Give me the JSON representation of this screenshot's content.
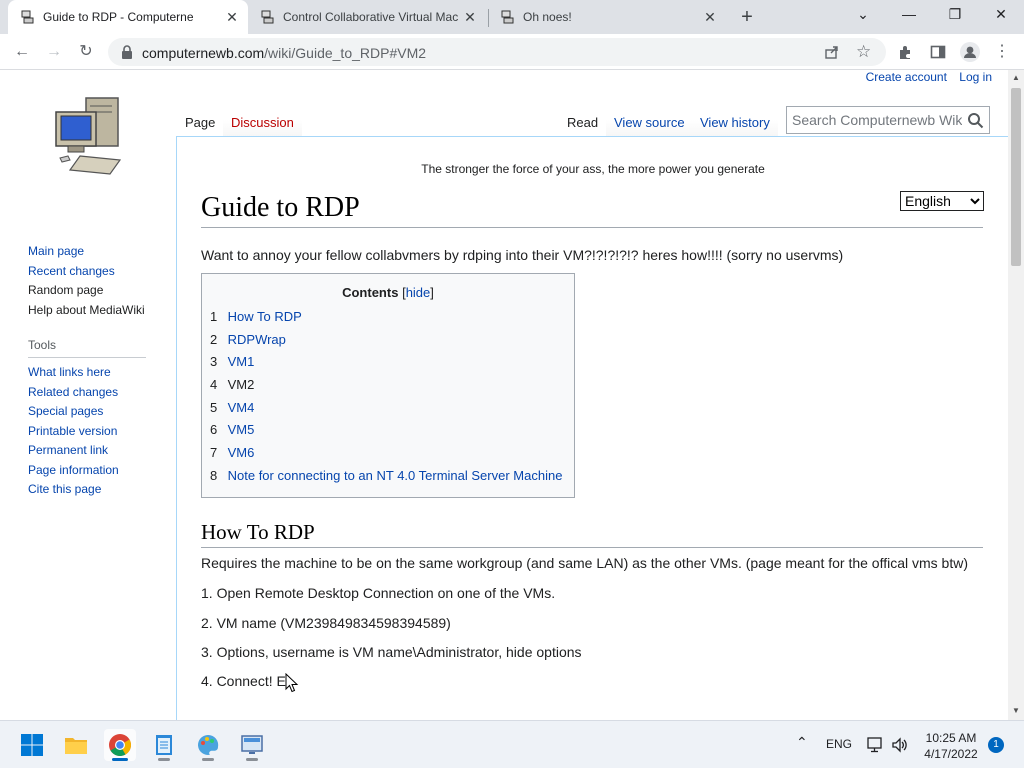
{
  "browser": {
    "tabs": [
      {
        "title": "Guide to RDP - Computernewb W",
        "close": "✕"
      },
      {
        "title": "Control Collaborative Virtual Mac",
        "close": "✕"
      },
      {
        "title": "Oh noes!",
        "close": "✕"
      }
    ],
    "new_tab": "+",
    "window_controls": {
      "tabsearch": "⌄",
      "minimize": "—",
      "restore": "❐",
      "close": "✕"
    },
    "url_host": "computernewb.com",
    "url_path": "/wiki/Guide_to_RDP#VM2"
  },
  "wiki": {
    "personal": {
      "create_account": "Create account",
      "login": "Log in"
    },
    "tabs": {
      "page": "Page",
      "discussion": "Discussion",
      "read": "Read",
      "view_source": "View source",
      "view_history": "View history"
    },
    "search_placeholder": "Search Computernewb Wiki",
    "sidebar": {
      "nav": [
        "Main page",
        "Recent changes",
        "Random page",
        "Help about MediaWiki"
      ],
      "tools_heading": "Tools",
      "tools": [
        "What links here",
        "Related changes",
        "Special pages",
        "Printable version",
        "Permanent link",
        "Page information",
        "Cite this page"
      ]
    },
    "site_notice": "The stronger the force of your ass, the more power you generate",
    "language": "English",
    "title": "Guide to RDP",
    "intro": "Want to annoy your fellow collabvmers by rdping into their VM?!?!?!?!? heres how!!!! (sorry no uservms)",
    "toc": {
      "title": "Contents",
      "toggle": "hide",
      "open_bracket": "[",
      "close_bracket": "]",
      "items": [
        {
          "num": "1",
          "label": "How To RDP"
        },
        {
          "num": "2",
          "label": "RDPWrap"
        },
        {
          "num": "3",
          "label": "VM1"
        },
        {
          "num": "4",
          "label": "VM2"
        },
        {
          "num": "5",
          "label": "VM4"
        },
        {
          "num": "6",
          "label": "VM5"
        },
        {
          "num": "7",
          "label": "VM6"
        },
        {
          "num": "8",
          "label": "Note for connecting to an NT 4.0 Terminal Server Machine"
        }
      ]
    },
    "section_heading": "How To RDP",
    "paragraphs": [
      "Requires the machine to be on the same workgroup (and same LAN) as the other VMs. (page meant for the offical vms btw)",
      "1. Open Remote Desktop Connection on one of the VMs.",
      "2. VM name (VM239849834598394589)",
      "3. Options, username is VM name\\Administrator, hide options",
      "4. Connect! E"
    ]
  },
  "taskbar": {
    "apps": [
      "start-icon",
      "file-explorer-icon",
      "chrome-icon",
      "notepad-icon",
      "paint-icon",
      "remote-desktop-icon"
    ],
    "language": "ENG",
    "time": "10:25 AM",
    "date": "4/17/2022",
    "notifications": "1"
  }
}
